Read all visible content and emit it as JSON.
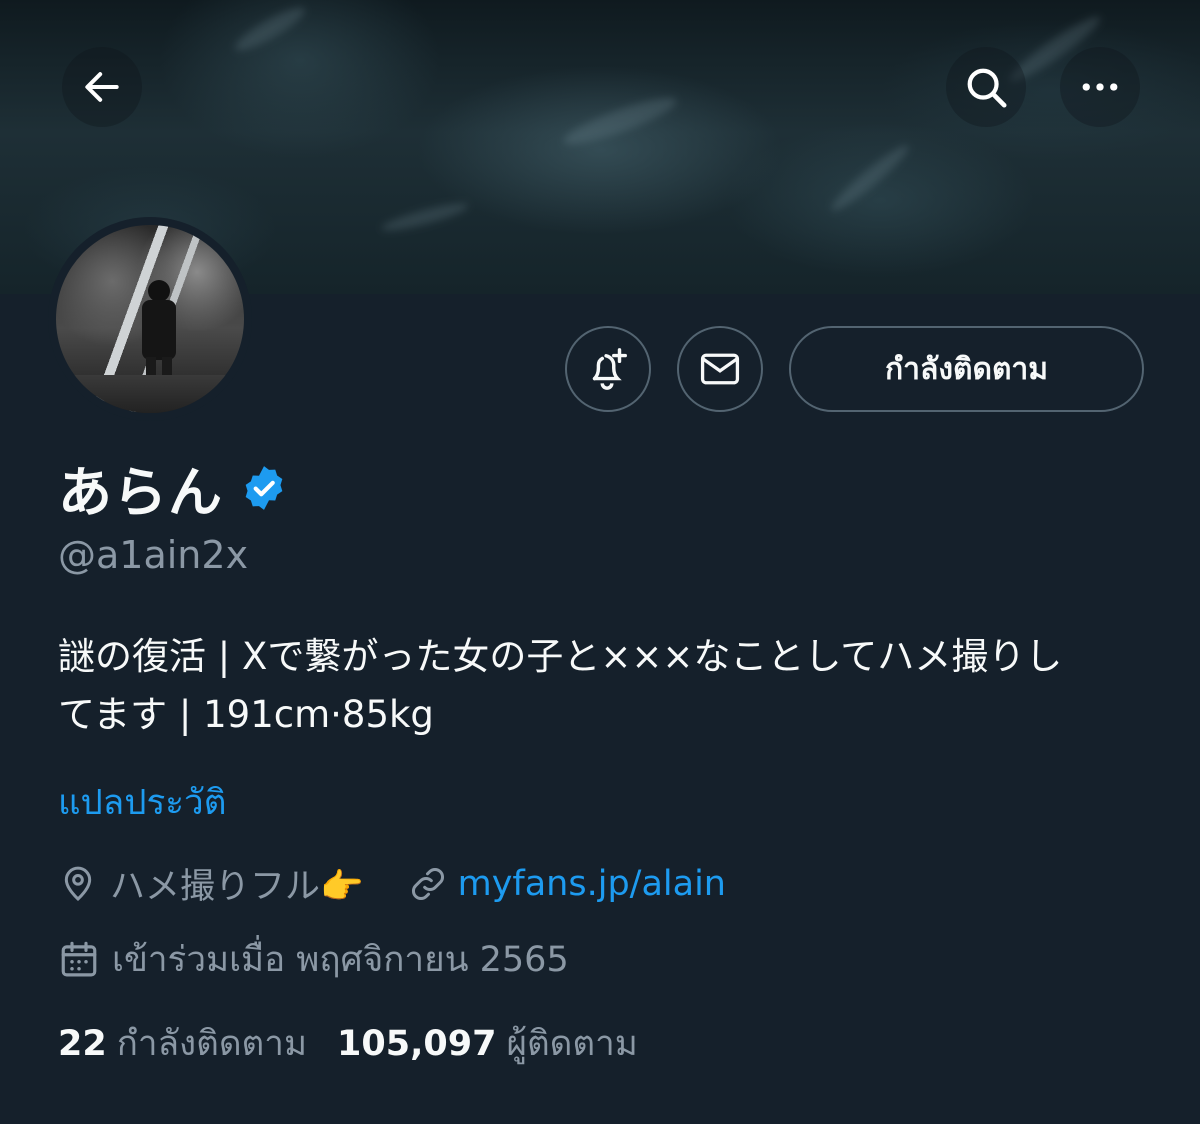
{
  "header": {
    "back_icon": "arrow-left-icon",
    "search_icon": "search-icon",
    "more_icon": "more-horizontal-icon"
  },
  "profile": {
    "display_name": "あらん",
    "verified_icon": "verified-badge-icon",
    "handle": "@a1ain2x",
    "bio_line1": "謎の復活 | Xで繋がった女の子と×××なことしてハメ撮りし",
    "bio_line2": "てます | 191cm·85kg",
    "translate_label": "แปลประวัติ",
    "location": "ハメ撮りフル👉",
    "website": "myfans.jp/alain",
    "joined": "เข้าร่วมเมื่อ พฤศจิกายน 2565"
  },
  "actions": {
    "notify_icon": "bell-plus-icon",
    "message_icon": "mail-icon",
    "follow_label": "กำลังติดตาม"
  },
  "stats": {
    "following_count": "22",
    "following_label": "กำลังติดตาม",
    "followers_count": "105,097",
    "followers_label": "ผู้ติดตาม"
  },
  "colors": {
    "background": "#15202b",
    "accent": "#1d9bf0",
    "secondary_text": "#8b98a5"
  }
}
